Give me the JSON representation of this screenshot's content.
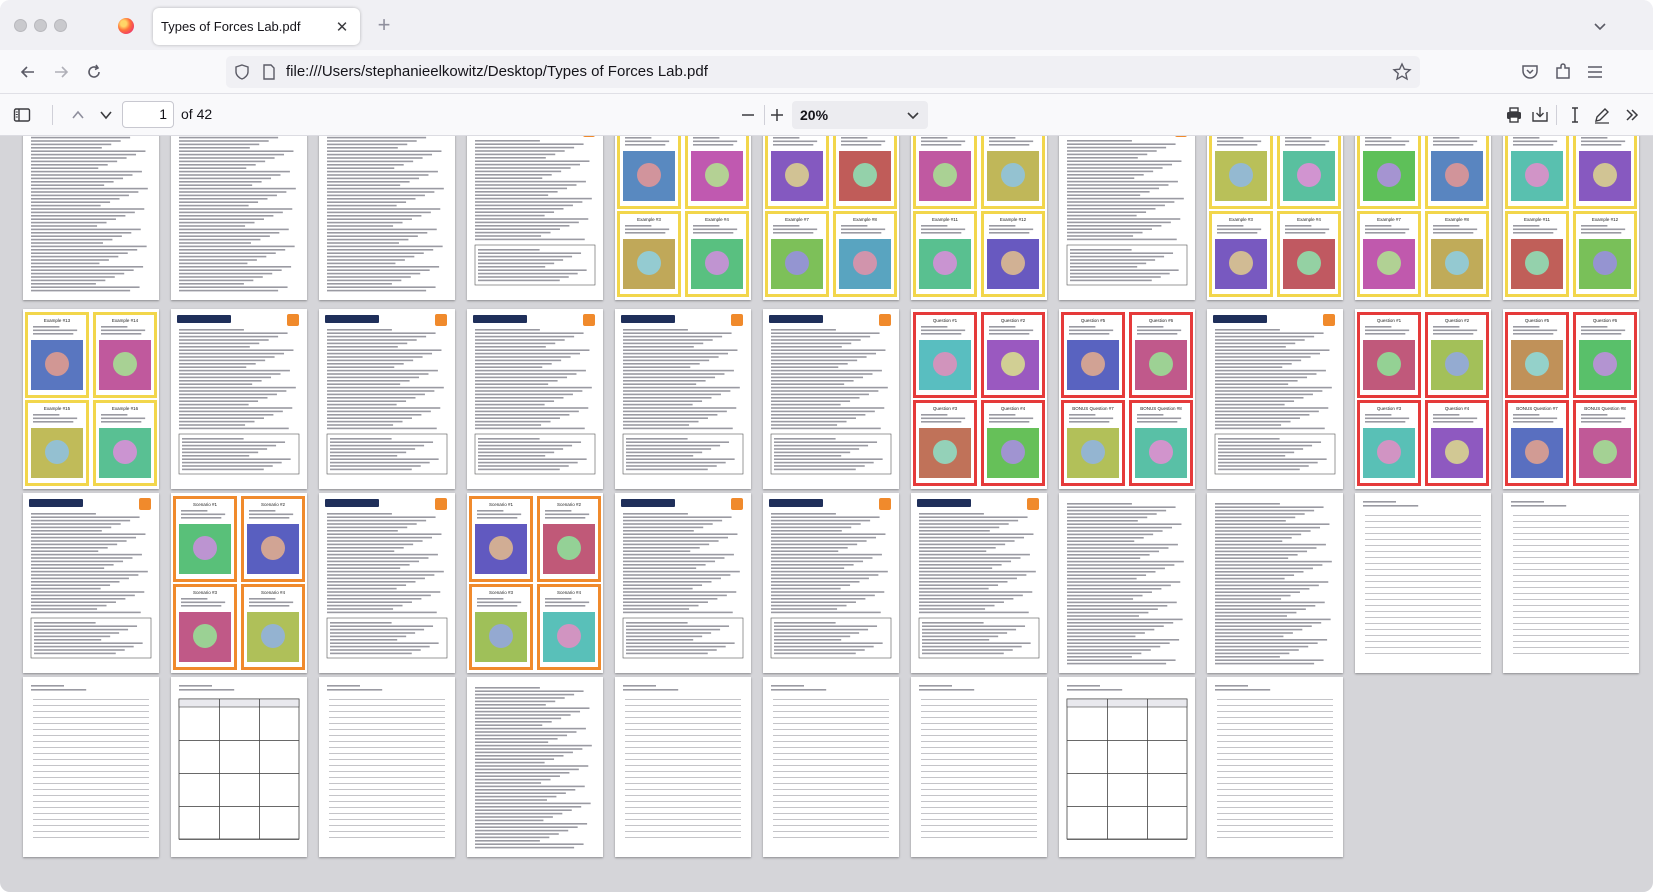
{
  "window": {
    "tab_title": "Types of Forces Lab.pdf"
  },
  "navbar": {
    "url": "file:///Users/stephanieelkowitz/Desktop/Types of Forces Lab.pdf"
  },
  "pdf_toolbar": {
    "page_number": "1",
    "page_total_label": "of 42",
    "zoom_value": "20%"
  },
  "colors": {
    "card_yellow": "#f2d64b",
    "card_red": "#e53a3a",
    "card_orange": "#f08a2c",
    "station_banner": "#1f2f5a",
    "firefox_accent": "#0061e0"
  },
  "thumbnails": [
    {
      "kind": "text"
    },
    {
      "kind": "text"
    },
    {
      "kind": "text"
    },
    {
      "kind": "station"
    },
    {
      "kind": "cards",
      "border": "yellow",
      "labels": [
        "Example #1",
        "Example #2",
        "Example #3",
        "Example #4"
      ]
    },
    {
      "kind": "cards",
      "border": "yellow",
      "labels": [
        "Example #5",
        "Example #6",
        "Example #7",
        "Example #8"
      ]
    },
    {
      "kind": "cards",
      "border": "yellow",
      "labels": [
        "Example #9",
        "Example #10",
        "Example #11",
        "Example #12"
      ]
    },
    {
      "kind": "station"
    },
    {
      "kind": "cards",
      "border": "yellow",
      "labels": [
        "Example #1",
        "Example #2",
        "Example #3",
        "Example #4"
      ]
    },
    {
      "kind": "cards",
      "border": "yellow",
      "labels": [
        "Example #5",
        "Example #6",
        "Example #7",
        "Example #8"
      ]
    },
    {
      "kind": "cards",
      "border": "yellow",
      "labels": [
        "Example #9",
        "Example #10",
        "Example #11",
        "Example #12"
      ]
    },
    {
      "kind": "cards",
      "border": "yellow",
      "labels": [
        "Example #13",
        "Example #14",
        "Example #15",
        "Example #16"
      ]
    },
    {
      "kind": "station"
    },
    {
      "kind": "station"
    },
    {
      "kind": "station"
    },
    {
      "kind": "station"
    },
    {
      "kind": "station"
    },
    {
      "kind": "cards",
      "border": "red",
      "labels": [
        "Question #1",
        "Question #2",
        "Question #3",
        "Question #4"
      ]
    },
    {
      "kind": "cards",
      "border": "red",
      "labels": [
        "Question #5",
        "Question #6",
        "BONUS Question #7",
        "BONUS Question #8"
      ]
    },
    {
      "kind": "station"
    },
    {
      "kind": "cards",
      "border": "red",
      "labels": [
        "Question #1",
        "Question #2",
        "Question #3",
        "Question #4"
      ]
    },
    {
      "kind": "cards",
      "border": "red",
      "labels": [
        "Question #5",
        "Question #6",
        "BONUS Question #7",
        "BONUS Question #8"
      ]
    },
    {
      "kind": "station"
    },
    {
      "kind": "cards",
      "border": "orange",
      "labels": [
        "Scenario #1",
        "Scenario #2",
        "Scenario #3",
        "Scenario #4"
      ]
    },
    {
      "kind": "station"
    },
    {
      "kind": "cards",
      "border": "orange",
      "labels": [
        "Scenario #1",
        "Scenario #2",
        "Scenario #3",
        "Scenario #4"
      ]
    },
    {
      "kind": "station"
    },
    {
      "kind": "station"
    },
    {
      "kind": "station"
    },
    {
      "kind": "text"
    },
    {
      "kind": "text"
    },
    {
      "kind": "lines"
    },
    {
      "kind": "lines"
    },
    {
      "kind": "lines"
    },
    {
      "kind": "table"
    },
    {
      "kind": "lines"
    },
    {
      "kind": "text"
    },
    {
      "kind": "lines"
    },
    {
      "kind": "lines"
    },
    {
      "kind": "lines"
    },
    {
      "kind": "table"
    },
    {
      "kind": "lines"
    }
  ]
}
